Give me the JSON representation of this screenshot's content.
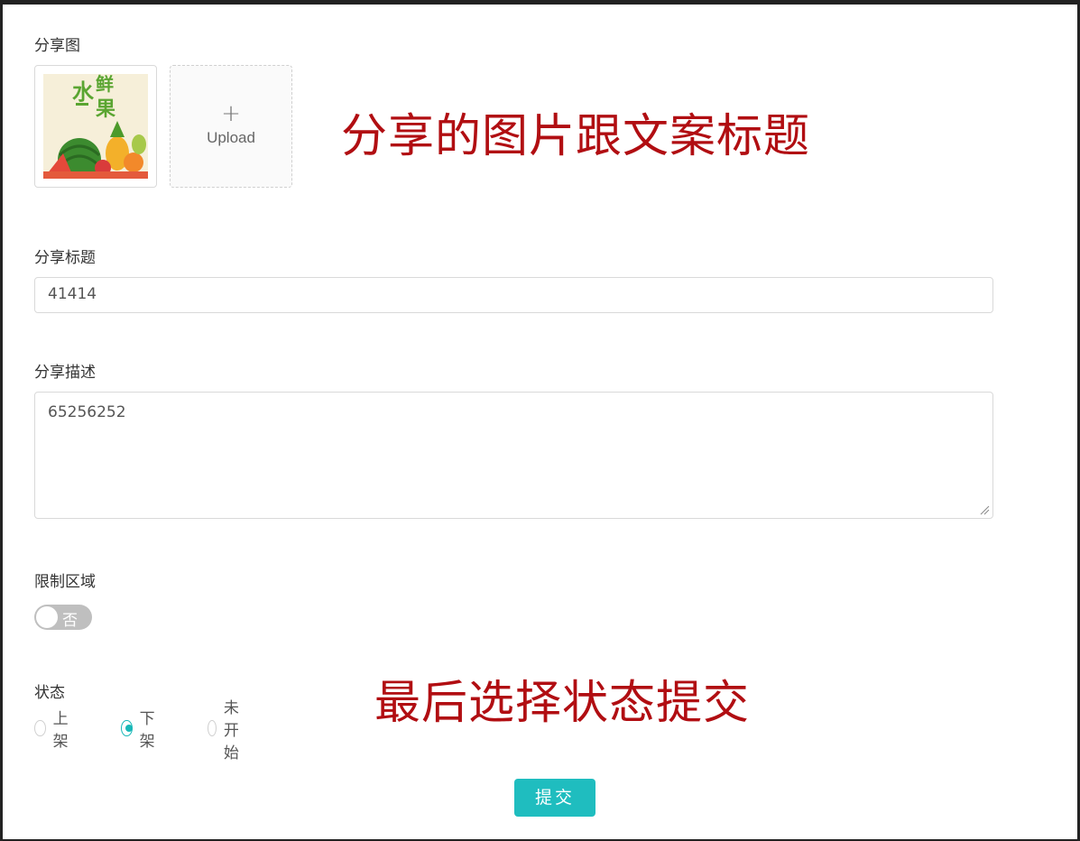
{
  "share_image": {
    "label": "分享图",
    "thumbnail_text": {
      "title": "水鲜果"
    },
    "upload_plus": "+",
    "upload_label": "Upload"
  },
  "annotations": {
    "top": "分享的图片跟文案标题",
    "bottom": "最后选择状态提交"
  },
  "share_title": {
    "label": "分享标题",
    "value": "41414"
  },
  "share_description": {
    "label": "分享描述",
    "value": "65256252"
  },
  "restricted_area": {
    "label": "限制区域",
    "switch_text": "否",
    "switch_on": false
  },
  "status": {
    "label": "状态",
    "options": [
      {
        "label": "上架",
        "checked": false
      },
      {
        "label": "下架",
        "checked": true
      },
      {
        "label": "未开始",
        "checked": false
      }
    ]
  },
  "submit_label": "提交",
  "colors": {
    "accent": "#1fbdbf",
    "annotation": "#b10e12",
    "switch_off": "#bfbfbf"
  }
}
